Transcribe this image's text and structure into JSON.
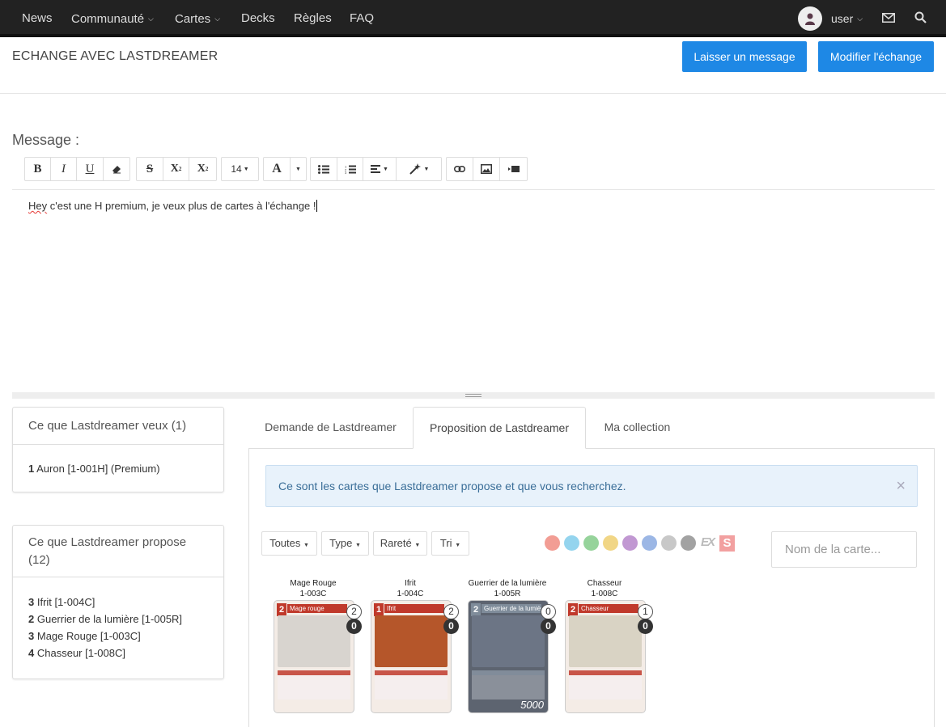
{
  "nav": {
    "items": [
      {
        "label": "News",
        "dropdown": false
      },
      {
        "label": "Communauté",
        "dropdown": true
      },
      {
        "label": "Cartes",
        "dropdown": true
      },
      {
        "label": "Decks",
        "dropdown": false
      },
      {
        "label": "Règles",
        "dropdown": false
      },
      {
        "label": "FAQ",
        "dropdown": false
      }
    ],
    "user": "user"
  },
  "header": {
    "title": "ECHANGE AVEC LASTDREAMER",
    "leave_message": "Laisser un message",
    "modify_trade": "Modifier l'échange"
  },
  "editor": {
    "label": "Message :",
    "font_size": "14",
    "text_misspelled": "Hey",
    "text_rest": " c'est une H premium, je veux plus de cartes à l'échange !"
  },
  "wants_panel": {
    "title": "Ce que Lastdreamer veux (1)",
    "items": [
      {
        "qty": "1",
        "name": "Auron [1-001H] (Premium)"
      }
    ]
  },
  "offers_panel": {
    "title": "Ce que Lastdreamer propose (12)",
    "items": [
      {
        "qty": "3",
        "name": "Ifrit [1-004C]"
      },
      {
        "qty": "2",
        "name": "Guerrier de la lumière [1-005R]"
      },
      {
        "qty": "3",
        "name": "Mage Rouge [1-003C]"
      },
      {
        "qty": "4",
        "name": "Chasseur [1-008C]"
      }
    ]
  },
  "tabs": [
    {
      "label": "Demande de Lastdreamer",
      "active": false
    },
    {
      "label": "Proposition de Lastdreamer",
      "active": true
    },
    {
      "label": "Ma collection",
      "active": false
    }
  ],
  "alert": {
    "text": "Ce sont les cartes que Lastdreamer propose et que vous recherchez.",
    "close": "×"
  },
  "filters": {
    "all": "Toutes",
    "type": "Type",
    "rarity": "Rareté",
    "sort": "Tri",
    "ex_label": "EX",
    "s_label": "S",
    "search_placeholder": "Nom de la carte..."
  },
  "elements": [
    {
      "name": "fire-element-icon",
      "color": "#e74c3c"
    },
    {
      "name": "ice-element-icon",
      "color": "#3cb0e0"
    },
    {
      "name": "wind-element-icon",
      "color": "#3fae49"
    },
    {
      "name": "earth-element-icon",
      "color": "#e6b422"
    },
    {
      "name": "lightning-element-icon",
      "color": "#8e44ad"
    },
    {
      "name": "water-element-icon",
      "color": "#4a7bd0"
    },
    {
      "name": "light-element-icon",
      "color": "#9a9a9a"
    },
    {
      "name": "dark-element-icon",
      "color": "#555555"
    }
  ],
  "cards": [
    {
      "name": "Mage Rouge",
      "code": "1-003C",
      "cost": "2",
      "title": "Mage rouge",
      "owned": "2",
      "have": "0",
      "art": "#d8d4cf",
      "accent": "#c0392b"
    },
    {
      "name": "Ifrit",
      "code": "1-004C",
      "cost": "1",
      "title": "Ifrit",
      "owned": "2",
      "have": "0",
      "art": "#b5562a",
      "accent": "#c0392b"
    },
    {
      "name": "Guerrier de la lumière",
      "code": "1-005R",
      "cost": "2",
      "title": "Guerrier de la lumière",
      "owned": "0",
      "have": "0",
      "art": "#6c7585",
      "accent": "#7f8c9a",
      "power": "5000"
    },
    {
      "name": "Chasseur",
      "code": "1-008C",
      "cost": "2",
      "title": "Chasseur",
      "owned": "1",
      "have": "0",
      "art": "#d9d3c4",
      "accent": "#c0392b"
    }
  ]
}
